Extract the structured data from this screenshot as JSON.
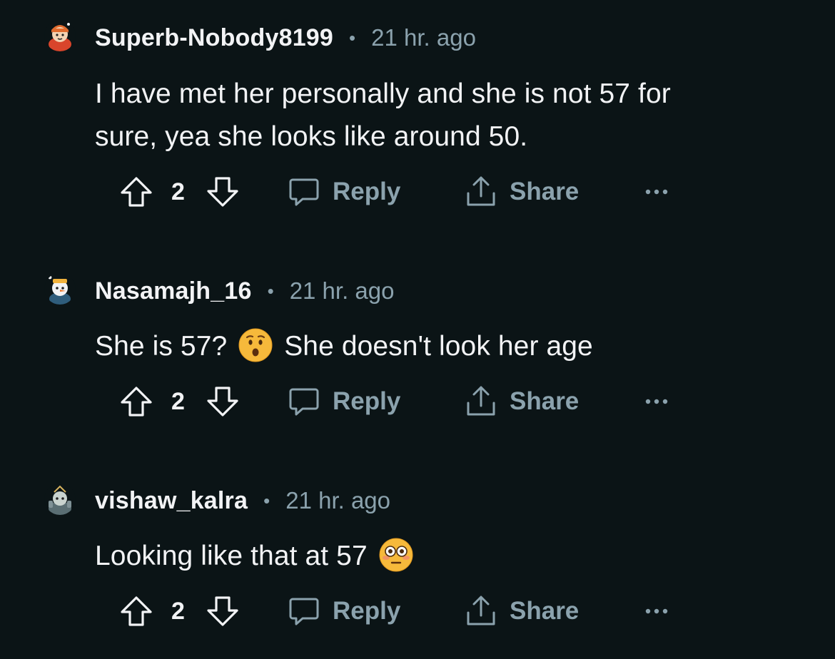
{
  "comments": [
    {
      "username": "Superb-Nobody8199",
      "separator": "•",
      "time": "21 hr. ago",
      "body_lines": [
        "I have met her personally and she is not 57 for",
        "sure, yea she looks like around 50."
      ],
      "votes": "2",
      "reply_label": "Reply",
      "share_label": "Share",
      "avatar_color": "#e4572e"
    },
    {
      "username": "Nasamajh_16",
      "separator": "•",
      "time": "21 hr. ago",
      "body_before": "She is 57?",
      "emoji": "hushed-face-emoji",
      "body_after": "She doesn't look her age",
      "votes": "2",
      "reply_label": "Reply",
      "share_label": "Share",
      "avatar_color": "#2f5d7c"
    },
    {
      "username": "vishaw_kalra",
      "separator": "•",
      "time": "21 hr. ago",
      "body_before": "Looking like that at 57",
      "emoji": "flushed-face-emoji",
      "votes": "2",
      "reply_label": "Reply",
      "share_label": "Share",
      "avatar_color": "#5a6e73"
    }
  ],
  "colors": {
    "background": "#0b1416",
    "text": "#f2f3f5",
    "muted": "#8ba2ad"
  }
}
